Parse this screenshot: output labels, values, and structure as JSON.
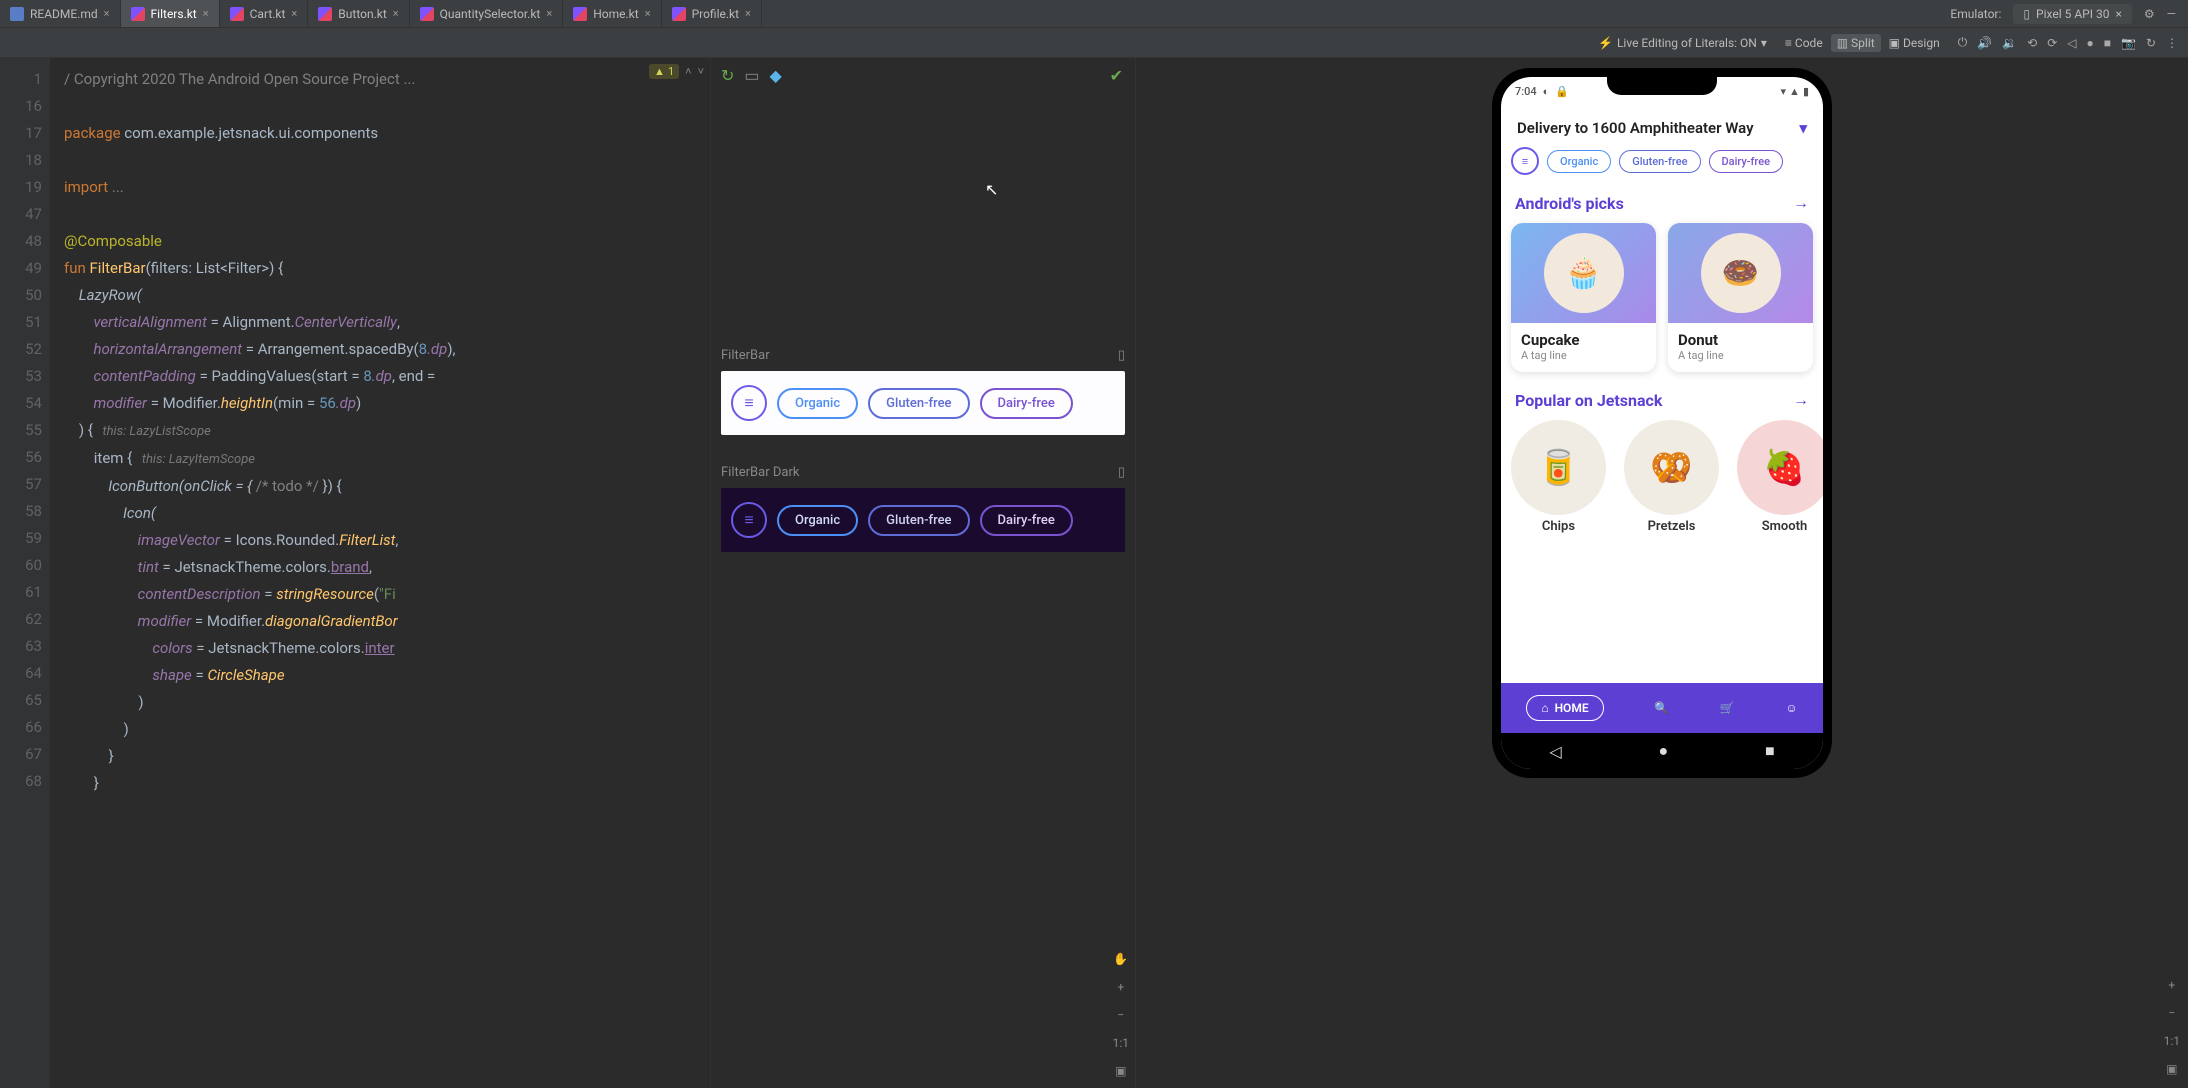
{
  "tabs": [
    {
      "label": "README.md"
    },
    {
      "label": "Filters.kt"
    },
    {
      "label": "Cart.kt"
    },
    {
      "label": "Button.kt"
    },
    {
      "label": "QuantitySelector.kt"
    },
    {
      "label": "Home.kt"
    },
    {
      "label": "Profile.kt"
    }
  ],
  "emulator": {
    "label": "Emulator:",
    "device": "Pixel 5 API 30"
  },
  "toolbar": {
    "live": "Live Editing of Literals: ON",
    "code": "Code",
    "split": "Split",
    "design": "Design"
  },
  "warnings": "1",
  "gutter": [
    "1",
    "16",
    "17",
    "18",
    "19",
    "47",
    "48",
    "49",
    "50",
    "51",
    "52",
    "53",
    "54",
    "55",
    "56",
    "57",
    "58",
    "59",
    "60",
    "61",
    "62",
    "63",
    "64",
    "65",
    "66",
    "67",
    "68"
  ],
  "code": {
    "l0a": "/",
    "l0b": " Copyright 2020 The Android Open Source Project ...",
    "pkg_kw": "package",
    "pkg": " com.example.jetsnack.ui.components",
    "imp_kw": "import",
    "imp": " ...",
    "ann": "@Composable",
    "fun_kw": "fun ",
    "fun_name": "FilterBar",
    "fun_sig": "(filters: List<Filter>) {",
    "lazy": "    LazyRow(",
    "va_k": "        verticalAlignment",
    "va_v": " = Alignment.",
    "va_v2": "CenterVertically",
    "comma": ",",
    "ha_k": "        horizontalArrangement",
    "ha_v": " = Arrangement.spacedBy(",
    "ha_n": "8",
    "ha_u": ".dp",
    "ha_e": "),",
    "cp_k": "        contentPadding",
    "cp_v": " = PaddingValues(start = ",
    "cp_n1": "8",
    "cp_u": ".dp",
    "cp_m": ", end = ",
    "mod_k": "        modifier",
    "mod_v": " = Modifier.",
    "mod_f": "heightIn",
    "mod_p": "(min = ",
    "mod_n": "56",
    "mod_u": ".dp",
    "mod_e": ")",
    "close1": "    ) {",
    "hint1": "   this: LazyListScope",
    "item": "        item {",
    "hint2": "   this: LazyItemScope",
    "iconbtn": "            IconButton(onClick = { ",
    "todo": "/* todo */",
    "iconbtn2": " }) {",
    "icon": "                Icon(",
    "iv_k": "                    imageVector",
    "iv_v": " = Icons.Rounded.",
    "iv_f": "FilterList",
    "tint_k": "                    tint",
    "tint_v": " = JetsnackTheme.colors.",
    "tint_f": "brand",
    "cd_k": "                    contentDescription",
    "cd_v": " = ",
    "cd_f": "stringResource",
    "cd_p": "(",
    "cd_s": "\"Fi",
    "m2_k": "                    modifier",
    "m2_v": " = Modifier.",
    "m2_f": "diagonalGradientBor",
    "col_k": "                        colors",
    "col_v": " = JetsnackTheme.colors.",
    "col_f": "inter",
    "sh_k": "                        shape",
    "sh_v": " = ",
    "sh_f": "CircleShape",
    "cp1": "                    )",
    "cp2": "                )",
    "cp3": "            }",
    "cp4": "        }"
  },
  "previews": {
    "label1": "FilterBar",
    "label2": "FilterBar Dark",
    "chips": [
      "Organic",
      "Gluten-free",
      "Dairy-free"
    ]
  },
  "side": {
    "oneone": "1:1"
  },
  "app": {
    "time": "7:04",
    "address": "Delivery to 1600 Amphitheater Way",
    "chips": [
      "Organic",
      "Gluten-free",
      "Dairy-free"
    ],
    "picks": "Android's picks",
    "snack1": {
      "name": "Cupcake",
      "tag": "A tag line"
    },
    "snack2": {
      "name": "Donut",
      "tag": "A tag line"
    },
    "popular": "Popular on Jetsnack",
    "pop": [
      "Chips",
      "Pretzels",
      "Smooth"
    ],
    "home": "HOME"
  }
}
